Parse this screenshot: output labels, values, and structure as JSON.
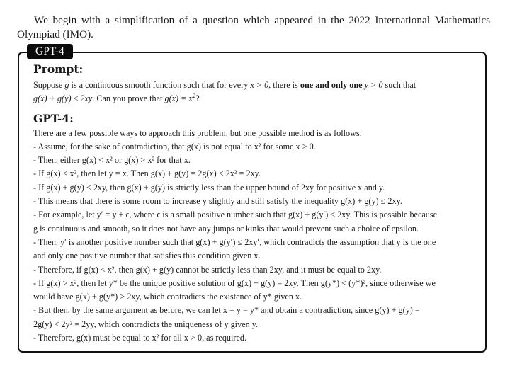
{
  "intro": {
    "text": "We begin with a simplification of a question which appeared in the 2022 International Mathematics Olympiad (IMO)."
  },
  "box": {
    "badge_label": "GPT-4",
    "prompt": {
      "heading": "Prompt:",
      "text_pre": "Suppose ",
      "g": "g",
      "text_mid": " is a continuous smooth function such that for every ",
      "cond1": "x > 0",
      "text_mid2": ", there is ",
      "bold": "one and only one",
      "space": " ",
      "cond2": "y > 0",
      "text_post": " such that",
      "line2_math": "g(x) + g(y) ≤ 2xy",
      "line2_text": ". Can you prove that ",
      "line2_math2": "g(x) = x",
      "line2_sup": "2",
      "line2_end": "?"
    },
    "response": {
      "heading": "GPT-4:",
      "lines": [
        "There are a few possible ways to approach this problem, but one possible method is as follows:",
        "- Assume, for the sake of contradiction, that g(x) is not equal to x² for some x > 0.",
        "- Then, either g(x) < x² or g(x) > x² for that x.",
        "- If g(x) < x², then let y = x. Then g(x) + g(y) = 2g(x) < 2x² = 2xy.",
        "- If g(x) + g(y) < 2xy, then g(x) + g(y) is strictly less than the upper bound of 2xy for positive x and y.",
        "- This means that there is some room to increase y slightly and still satisfy the inequality g(x) + g(y) ≤ 2xy.",
        "- For example, let y′ = y + ϵ, where ϵ is a small positive number such that g(x) + g(y′) < 2xy. This is possible because",
        "g is continuous and smooth, so it does not have any jumps or kinks that would prevent such a choice of epsilon.",
        "- Then, y′ is another positive number such that g(x) + g(y′) ≤ 2xy′, which contradicts the assumption that y is the one",
        "and only one positive number that satisfies this condition given x.",
        "- Therefore, if g(x) < x², then g(x) + g(y) cannot be strictly less than 2xy, and it must be equal to 2xy.",
        "- If g(x) > x², then let y* be the unique positive solution of g(x) + g(y) = 2xy. Then g(y*) < (y*)², since otherwise we",
        "would have g(x) + g(y*) > 2xy, which contradicts the existence of y* given x.",
        "- But then, by the same argument as before, we can let x = y = y* and obtain a contradiction, since g(y) + g(y) =",
        "2g(y) < 2y² = 2yy, which contradicts the uniqueness of y given y.",
        "- Therefore, g(x) must be equal to x² for all x > 0, as required."
      ]
    }
  }
}
